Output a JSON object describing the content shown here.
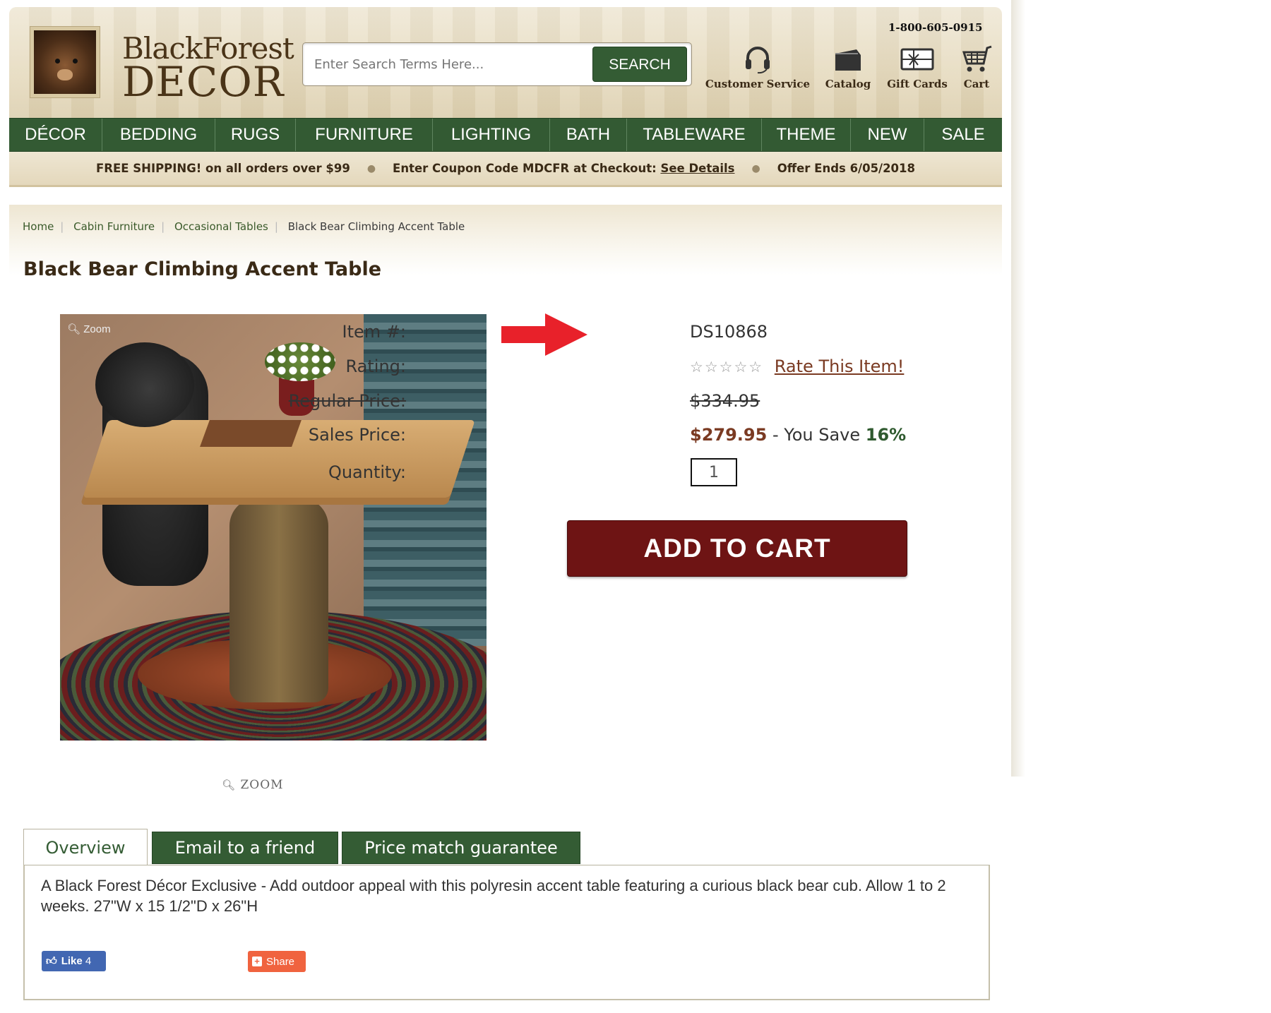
{
  "header": {
    "logo_line1": "BlackForest",
    "logo_line2": "DECOR",
    "phone": "1-800-605-0915",
    "search_placeholder": "Enter Search Terms Here...",
    "search_button": "SEARCH",
    "icons": [
      {
        "label": "Customer Service",
        "icon": "headset-icon"
      },
      {
        "label": "Catalog",
        "icon": "catalog-icon"
      },
      {
        "label": "Gift Cards",
        "icon": "gift-card-icon"
      },
      {
        "label": "Cart",
        "icon": "cart-icon"
      }
    ]
  },
  "nav": [
    "DÉCOR",
    "BEDDING",
    "RUGS",
    "FURNITURE",
    "LIGHTING",
    "BATH",
    "TABLEWARE",
    "THEME",
    "NEW",
    "SALE"
  ],
  "promo": {
    "shipping": "FREE SHIPPING! on all orders over $99",
    "coupon": "Enter Coupon Code MDCFR at Checkout:",
    "details_link": "See Details",
    "offer": "Offer Ends 6/05/2018"
  },
  "breadcrumb": [
    "Home",
    "Cabin Furniture",
    "Occasional Tables",
    "Black Bear Climbing Accent Table"
  ],
  "product": {
    "title": "Black Bear Climbing Accent Table",
    "image_zoom_tag": "Zoom",
    "zoom_link": "ZOOM",
    "item_label": "Item #:",
    "item_value": "DS10868",
    "rating_label": "Rating:",
    "rating_stars": "☆☆☆☆☆",
    "rating_value": 0,
    "rate_link": "Rate This Item!",
    "regular_label": "Regular Price:",
    "regular_value": "$334.95",
    "sales_label": "Sales Price:",
    "sales_value": "$279.95",
    "save_text": " - You Save ",
    "save_pct": "16%",
    "quantity_label": "Quantity:",
    "quantity_value": "1",
    "add_to_cart": "ADD TO CART"
  },
  "tabs": [
    "Overview",
    "Email to a friend",
    "Price match guarantee"
  ],
  "overview": {
    "description": "A Black Forest Décor Exclusive - Add outdoor appeal with this polyresin accent table featuring a curious black bear cub. Allow 1 to 2 weeks. 27\"W x 15 1/2\"D x 26\"H",
    "like_label": "Like",
    "like_count": "4",
    "share_label": "Share"
  },
  "colors": {
    "nav_green": "#335a33",
    "cart_button": "#6e1414",
    "price": "#7a3a22",
    "arrow_red": "#e8212a"
  }
}
